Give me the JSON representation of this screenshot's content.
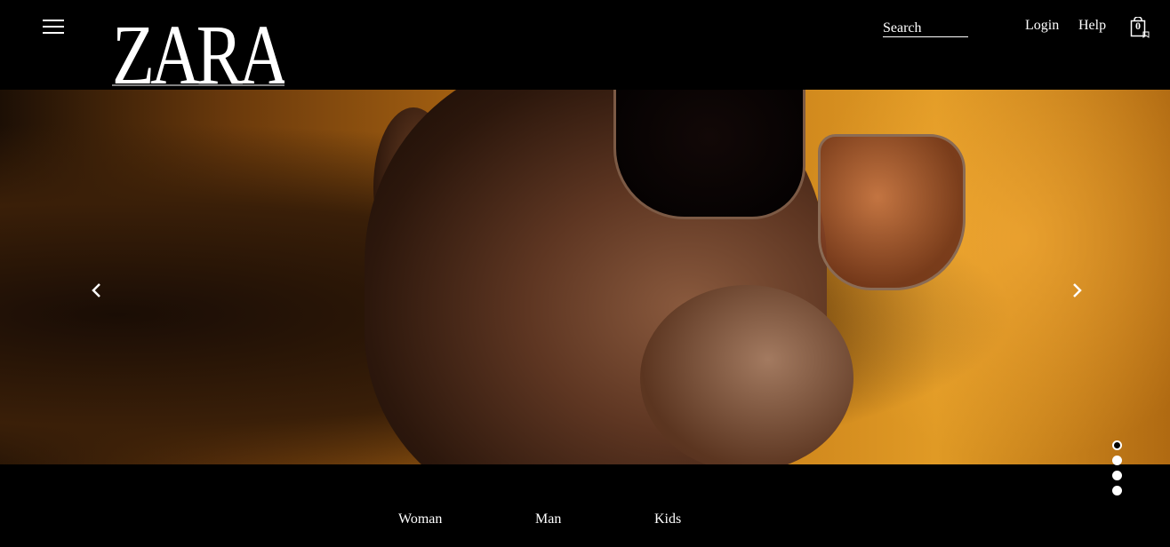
{
  "header": {
    "logo_text": "ZARA",
    "search_label": "Search",
    "login_label": "Login",
    "help_label": "Help",
    "bag_count": "0",
    "icons": {
      "menu": "hamburger-menu-icon",
      "bag": "shopping-bag-icon"
    }
  },
  "hero": {
    "image_semantic": "campaign-hero-image",
    "prev_icon": "chevron-left-icon",
    "next_icon": "chevron-right-icon",
    "slide_count": 4,
    "active_slide": 1
  },
  "bottom_nav": {
    "items": [
      {
        "label": "Woman"
      },
      {
        "label": "Man"
      },
      {
        "label": "Kids"
      }
    ]
  },
  "colors": {
    "background": "#000000",
    "text": "#ffffff",
    "hero_accent": "#c67d18"
  }
}
